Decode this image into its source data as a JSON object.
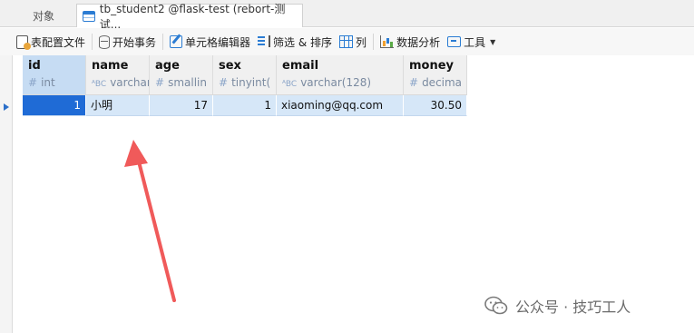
{
  "tabs": {
    "objects_label": "对象",
    "active_label": "tb_student2 @flask-test (rebort-测试..."
  },
  "toolbar": {
    "config_label": "表配置文件",
    "begin_txn_label": "开始事务",
    "cell_editor_label": "单元格编辑器",
    "filter_sort_label": "筛选 & 排序",
    "columns_label": "列",
    "analysis_label": "数据分析",
    "tools_label": "工具"
  },
  "columns": [
    {
      "name": "id",
      "type": "int",
      "glyph": "#"
    },
    {
      "name": "name",
      "type": "varchar",
      "glyph": "ᴬBC"
    },
    {
      "name": "age",
      "type": "smallin",
      "glyph": "#"
    },
    {
      "name": "sex",
      "type": "tinyint(",
      "glyph": "#"
    },
    {
      "name": "email",
      "type": "varchar(128)",
      "glyph": "ᴬBC"
    },
    {
      "name": "money",
      "type": "decima",
      "glyph": "#"
    }
  ],
  "rows": [
    {
      "id": "1",
      "name": "小明",
      "age": "17",
      "sex": "1",
      "email": "xiaoming@qq.com",
      "money": "30.50"
    }
  ],
  "watermark": {
    "text": "公众号 · 技巧工人"
  },
  "colors": {
    "selection_blue": "#1f6bd6",
    "row_highlight": "#d6e7f8",
    "arrow_red": "#f05a5a"
  }
}
